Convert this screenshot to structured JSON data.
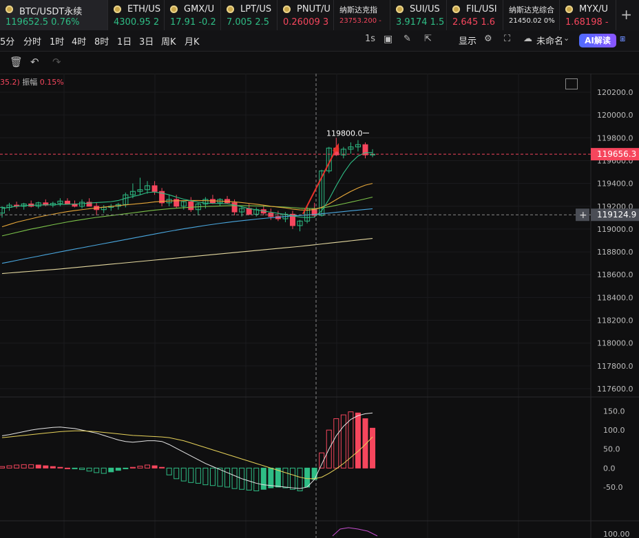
{
  "tabs": [
    {
      "symbol": "BTC/USDT永续",
      "price": "119652.5",
      "change": "0.76%",
      "active": true,
      "small": false,
      "color": "#2ebd85",
      "price_color": "#2ebd85"
    },
    {
      "symbol": "ETH/US",
      "price": "4300.95",
      "change": "2",
      "small": false,
      "color": "#2ebd85"
    },
    {
      "symbol": "GMX/U",
      "price": "17.91",
      "change": "-0.2",
      "small": false,
      "color": "#2ebd85"
    },
    {
      "symbol": "LPT/US",
      "price": "7.005",
      "change": "2.5",
      "small": false,
      "color": "#2ebd85"
    },
    {
      "symbol": "PNUT/U",
      "price": "0.26009",
      "change": "3",
      "small": false,
      "color": "#f6465d"
    },
    {
      "symbol": "纳斯达克指",
      "price": "23753.200",
      "change": "-",
      "small": true,
      "color": "#f6465d"
    },
    {
      "symbol": "SUI/US",
      "price": "3.9174",
      "change": "1.5",
      "small": false,
      "color": "#2ebd85"
    },
    {
      "symbol": "FIL/USI",
      "price": "2.645",
      "change": "1.6",
      "small": false,
      "color": "#f6465d"
    },
    {
      "symbol": "纳斯达克综合",
      "price": "21450.02",
      "change": "0%",
      "small": true,
      "color": "#e8e8e8"
    },
    {
      "symbol": "MYX/U",
      "price": "1.68198",
      "change": "-",
      "small": false,
      "color": "#f6465d"
    }
  ],
  "add_tab_label": "+",
  "timeframes": [
    "5分",
    "分时",
    "1时",
    "4时",
    "8时",
    "1日",
    "3日",
    "周K",
    "月K"
  ],
  "toolbar": {
    "interval": "1s",
    "display_label": "显示",
    "layout_name": "未命名",
    "ai_label": "AI解读"
  },
  "info": {
    "prefix": "35.2)",
    "amplitude_label": "振幅",
    "amplitude_value": "0.15%"
  },
  "colors": {
    "up": "#2ebd85",
    "down": "#f6465d",
    "bg": "#0f0f10",
    "grid": "#1c1c1f"
  },
  "chart_data": {
    "type": "candlestick",
    "ylim": [
      117600,
      120200
    ],
    "price_ticks": [
      "120200.0",
      "120000.0",
      "119800.0",
      "119600.0",
      "119400.0",
      "119200.0",
      "119000.0",
      "118800.0",
      "118600.0",
      "118400.0",
      "118200.0",
      "118000.0",
      "117800.0",
      "117600.0"
    ],
    "last_price": "119656.3",
    "last_price_value": 119656.3,
    "crosshair_price": "119124.9",
    "crosshair_value": 119124.9,
    "high_annotation": "119800.0",
    "high_value": 119800,
    "candles": [
      [
        119140,
        119200,
        119100,
        119190
      ],
      [
        119190,
        119230,
        119160,
        119210
      ],
      [
        119210,
        119240,
        119180,
        119200
      ],
      [
        119200,
        119230,
        119170,
        119220
      ],
      [
        119220,
        119250,
        119190,
        119200
      ],
      [
        119200,
        119240,
        119180,
        119230
      ],
      [
        119230,
        119260,
        119200,
        119210
      ],
      [
        119210,
        119240,
        119190,
        119225
      ],
      [
        119225,
        119270,
        119200,
        119245
      ],
      [
        119245,
        119270,
        119220,
        119220
      ],
      [
        119220,
        119250,
        119190,
        119200
      ],
      [
        119200,
        119260,
        119180,
        119235
      ],
      [
        119235,
        119270,
        119210,
        119200
      ],
      [
        119200,
        119230,
        119120,
        119170
      ],
      [
        119170,
        119210,
        119140,
        119190
      ],
      [
        119190,
        119220,
        119160,
        119200
      ],
      [
        119200,
        119230,
        119170,
        119215
      ],
      [
        119215,
        119320,
        119190,
        119300
      ],
      [
        119300,
        119400,
        119270,
        119330
      ],
      [
        119330,
        119450,
        119300,
        119345
      ],
      [
        119345,
        119420,
        119310,
        119380
      ],
      [
        119380,
        119420,
        119300,
        119330
      ],
      [
        119330,
        119360,
        119200,
        119230
      ],
      [
        119230,
        119300,
        119200,
        119260
      ],
      [
        119260,
        119300,
        119180,
        119200
      ],
      [
        119200,
        119250,
        119170,
        119240
      ],
      [
        119240,
        119280,
        119150,
        119170
      ],
      [
        119170,
        119230,
        119120,
        119220
      ],
      [
        119220,
        119280,
        119180,
        119260
      ],
      [
        119260,
        119300,
        119220,
        119230
      ],
      [
        119230,
        119270,
        119200,
        119260
      ],
      [
        119260,
        119290,
        119220,
        119230
      ],
      [
        119230,
        119260,
        119120,
        119150
      ],
      [
        119150,
        119200,
        119110,
        119180
      ],
      [
        119180,
        119220,
        119120,
        119130
      ],
      [
        119130,
        119190,
        119110,
        119170
      ],
      [
        119170,
        119210,
        119120,
        119140
      ],
      [
        119140,
        119180,
        119080,
        119110
      ],
      [
        119110,
        119160,
        119070,
        119090
      ],
      [
        119090,
        119150,
        119060,
        119130
      ],
      [
        119130,
        119160,
        119000,
        119030
      ],
      [
        119030,
        119080,
        118980,
        119070
      ],
      [
        119070,
        119200,
        119050,
        119180
      ],
      [
        119180,
        119230,
        119100,
        119120
      ],
      [
        119120,
        119520,
        119110,
        119510
      ],
      [
        119510,
        119720,
        119490,
        119710
      ],
      [
        119710,
        119800,
        119640,
        119650
      ],
      [
        119650,
        119720,
        119620,
        119700
      ],
      [
        119700,
        119760,
        119660,
        119720
      ],
      [
        119720,
        119780,
        119680,
        119740
      ],
      [
        119740,
        119760,
        119620,
        119650
      ],
      [
        119650,
        119700,
        119630,
        119656
      ]
    ],
    "ma_fast": [
      119180,
      119190,
      119200,
      119205,
      119208,
      119210,
      119212,
      119213,
      119215,
      119217,
      119219,
      119222,
      119228,
      119232,
      119236,
      119240,
      119250,
      119270,
      119285,
      119300,
      119320,
      119325,
      119315,
      119300,
      119280,
      119262,
      119248,
      119236,
      119228,
      119225,
      119224,
      119222,
      119210,
      119195,
      119180,
      119168,
      119158,
      119148,
      119138,
      119128,
      119115,
      119105,
      119100,
      119105,
      119160,
      119260,
      119380,
      119490,
      119580,
      119640,
      119670,
      119670
    ],
    "ma_mid": [
      119020,
      119040,
      119060,
      119075,
      119090,
      119105,
      119118,
      119130,
      119142,
      119153,
      119162,
      119170,
      119178,
      119185,
      119192,
      119198,
      119205,
      119212,
      119218,
      119224,
      119230,
      119238,
      119243,
      119246,
      119248,
      119249,
      119250,
      119250,
      119249,
      119247,
      119245,
      119242,
      119238,
      119232,
      119225,
      119218,
      119210,
      119200,
      119192,
      119185,
      119175,
      119168,
      119165,
      119172,
      119190,
      119220,
      119258,
      119295,
      119330,
      119360,
      119385,
      119400
    ],
    "ma_slow": [
      118940,
      118955,
      118970,
      118985,
      119000,
      119012,
      119025,
      119038,
      119050,
      119062,
      119073,
      119083,
      119093,
      119102,
      119110,
      119118,
      119126,
      119134,
      119142,
      119150,
      119158,
      119166,
      119172,
      119178,
      119183,
      119187,
      119191,
      119195,
      119198,
      119200,
      119202,
      119204,
      119205,
      119205,
      119204,
      119203,
      119201,
      119198,
      119195,
      119192,
      119188,
      119183,
      119180,
      119180,
      119185,
      119195,
      119208,
      119222,
      119236,
      119250,
      119265,
      119280
    ],
    "ma_blue": [
      118700,
      118712,
      118725,
      118738,
      118750,
      118762,
      118775,
      118787,
      118800,
      118812,
      118824,
      118836,
      118848,
      118860,
      118872,
      118884,
      118896,
      118908,
      118920,
      118932,
      118944,
      118956,
      118968,
      118980,
      118991,
      119002,
      119012,
      119022,
      119032,
      119041,
      119050,
      119058,
      119066,
      119073,
      119080,
      119087,
      119093,
      119099,
      119105,
      119110,
      119115,
      119119,
      119123,
      119128,
      119134,
      119140,
      119147,
      119153,
      119160,
      119166,
      119172,
      119178
    ],
    "ma_long": [
      118610,
      118615,
      118620,
      118625,
      118630,
      118635,
      118640,
      118645,
      118650,
      118656,
      118662,
      118668,
      118674,
      118680,
      118686,
      118692,
      118698,
      118704,
      118710,
      118716,
      118722,
      118728,
      118734,
      118740,
      118746,
      118752,
      118758,
      118764,
      118770,
      118776,
      118782,
      118788,
      118794,
      118800,
      118806,
      118812,
      118818,
      118824,
      118830,
      118836,
      118842,
      118848,
      118855,
      118862,
      118869,
      118876,
      118883,
      118890,
      118897,
      118904,
      118911,
      118918
    ],
    "macd": {
      "ylim": [
        -70,
        160
      ],
      "ticks": [
        "150.0",
        "100.0",
        "50.0",
        "0.0",
        "-50.0"
      ],
      "hist": [
        4,
        6,
        8,
        9,
        9,
        8,
        6,
        4,
        2,
        0,
        -2,
        -4,
        -8,
        -12,
        -14,
        -10,
        -6,
        -2,
        2,
        5,
        8,
        6,
        2,
        -18,
        -28,
        -34,
        -38,
        -40,
        -44,
        -46,
        -48,
        -50,
        -54,
        -56,
        -58,
        -60,
        -56,
        -52,
        -50,
        -52,
        -56,
        -60,
        -50,
        -30,
        40,
        100,
        130,
        140,
        148,
        145,
        130,
        105
      ],
      "dif": [
        85,
        88,
        92,
        96,
        100,
        103,
        105,
        107,
        108,
        106,
        104,
        100,
        96,
        92,
        86,
        80,
        74,
        70,
        68,
        70,
        72,
        72,
        70,
        62,
        52,
        42,
        32,
        22,
        12,
        4,
        -4,
        -12,
        -20,
        -28,
        -34,
        -40,
        -44,
        -46,
        -48,
        -50,
        -52,
        -54,
        -50,
        -30,
        10,
        50,
        85,
        110,
        128,
        138,
        143,
        145
      ],
      "dea": [
        80,
        82,
        84,
        86,
        88,
        90,
        92,
        94,
        96,
        97,
        98,
        98,
        97,
        96,
        94,
        92,
        90,
        88,
        86,
        85,
        84,
        83,
        82,
        80,
        76,
        72,
        66,
        60,
        54,
        48,
        42,
        36,
        30,
        24,
        18,
        12,
        6,
        0,
        -6,
        -12,
        -18,
        -24,
        -28,
        -28,
        -24,
        -14,
        -2,
        12,
        28,
        44,
        62,
        82
      ]
    }
  }
}
